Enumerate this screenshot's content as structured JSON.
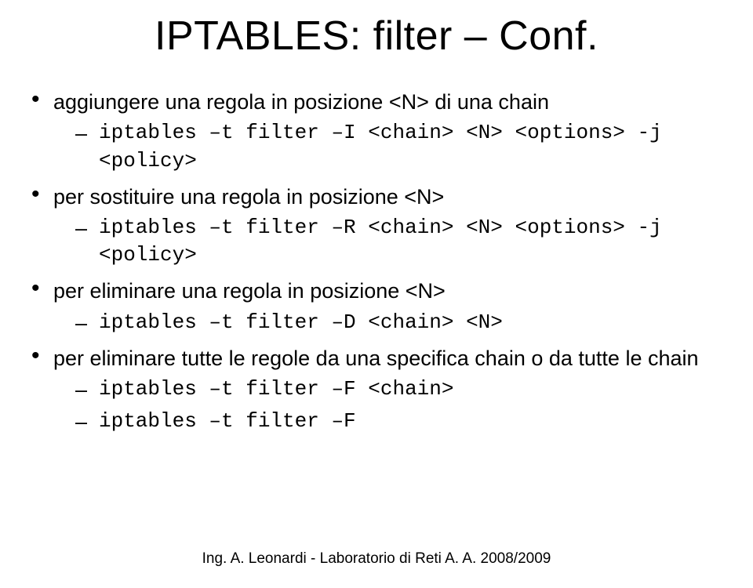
{
  "title": "IPTABLES: filter – Conf.",
  "bullets": [
    {
      "text": "aggiungere una regola in posizione <N> di una chain",
      "sub": [
        "iptables –t filter –I <chain> <N> <options> -j <policy>"
      ]
    },
    {
      "text": "per sostituire una regola in posizione <N>",
      "sub": [
        "iptables –t filter –R <chain> <N> <options> -j <policy>"
      ]
    },
    {
      "text": "per eliminare una regola in posizione <N>",
      "sub": [
        "iptables –t filter –D <chain> <N>"
      ]
    },
    {
      "text": "per eliminare tutte le regole da una specifica chain o da tutte le chain",
      "sub": [
        "iptables –t filter –F <chain>",
        "iptables –t filter –F"
      ]
    }
  ],
  "footer": "Ing. A. Leonardi - Laboratorio di Reti A. A. 2008/2009"
}
